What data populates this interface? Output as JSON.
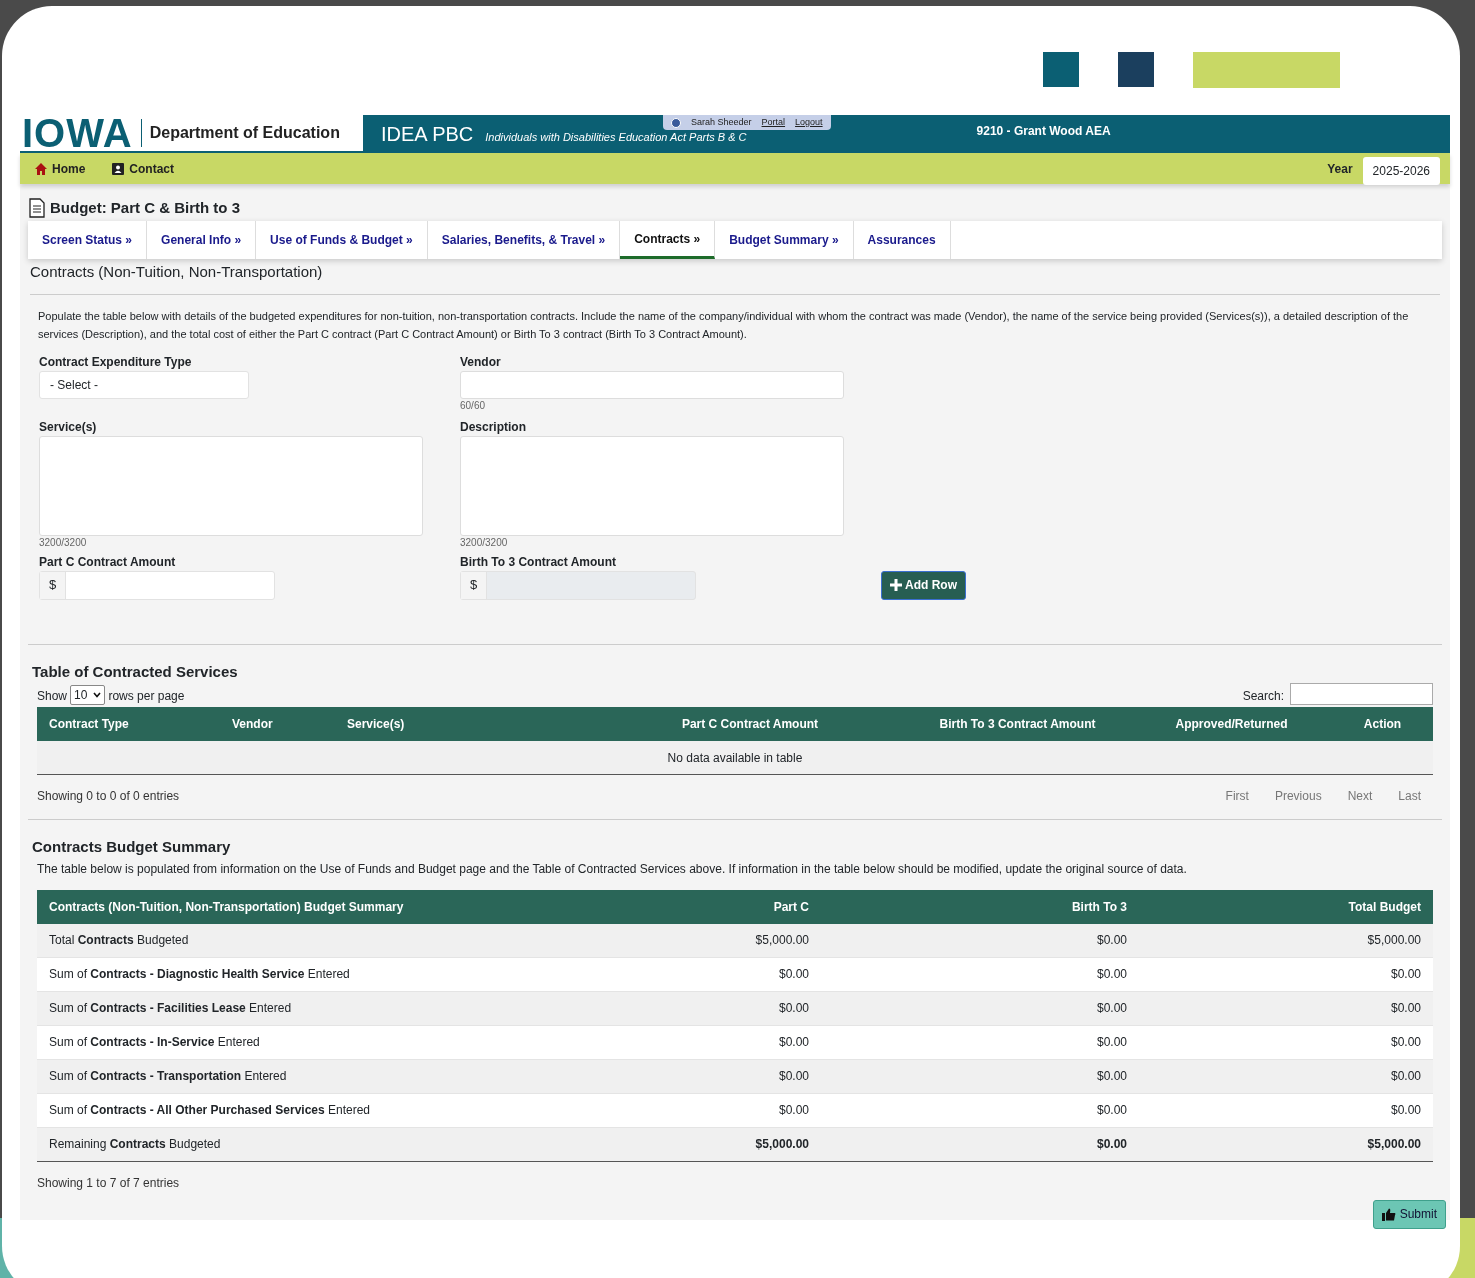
{
  "header": {
    "logo": "IOWA",
    "department": "Department of Education",
    "app_title": "IDEA PBC",
    "app_subtitle": "Individuals with Disabilities Education Act Parts B & C",
    "user": "Sarah Sheeder",
    "user_links": [
      "Portal",
      "Logout"
    ],
    "agency": "9210 - Grant Wood AEA"
  },
  "nav": {
    "items": [
      "Home",
      "Contact"
    ],
    "year_label": "Year",
    "year_value": "2025-2026"
  },
  "page_title": "Budget: Part C & Birth to 3",
  "tabs": [
    {
      "label": "Screen Status »",
      "selected": false
    },
    {
      "label": "General Info »",
      "selected": false
    },
    {
      "label": "Use of Funds & Budget »",
      "selected": false
    },
    {
      "label": "Salaries, Benefits, & Travel »",
      "selected": false
    },
    {
      "label": "Contracts »",
      "selected": true
    },
    {
      "label": "Budget Summary »",
      "selected": false
    },
    {
      "label": "Assurances",
      "selected": false
    }
  ],
  "section_title": "Contracts (Non-Tuition, Non-Transportation)",
  "instructions": "Populate the table below with details of the budgeted expenditures for non-tuition, non-transportation contracts. Include the name of the company/individual with whom the contract was made (Vendor), the name of the service being provided (Services(s)), a detailed description of the services (Description), and the total cost of either the Part C contract (Part C Contract Amount) or Birth To 3 contract (Birth To 3 Contract Amount).",
  "form": {
    "expenditure_type": {
      "label": "Contract Expenditure Type",
      "value": "- Select -"
    },
    "vendor": {
      "label": "Vendor",
      "counter": "60/60"
    },
    "services": {
      "label": "Service(s)",
      "counter": "3200/3200"
    },
    "description": {
      "label": "Description",
      "counter": "3200/3200"
    },
    "part_c_amount": {
      "label": "Part C Contract Amount",
      "prefix": "$",
      "disabled": false
    },
    "birth_to_3_amount": {
      "label": "Birth To 3 Contract Amount",
      "prefix": "$",
      "disabled": true
    },
    "add_button": "Add Row"
  },
  "contracted_table": {
    "title": "Table of Contracted Services",
    "show_label": "Show",
    "page_size": "10",
    "rows_per_page_label": "rows per page",
    "search_label": "Search:",
    "columns": [
      "Contract Type",
      "Vendor",
      "Service(s)",
      "Part C Contract Amount",
      "Birth To 3 Contract Amount",
      "Approved/Returned",
      "Action"
    ],
    "empty_message": "No data available in table",
    "info": "Showing 0 to 0 of 0 entries",
    "pagination": [
      "First",
      "Previous",
      "Next",
      "Last"
    ]
  },
  "summary": {
    "title": "Contracts Budget Summary",
    "description": "The table below is populated from information on the Use of Funds and Budget page and the Table of Contracted Services above. If information in the table below should be modified, update the original source of data.",
    "columns": [
      "Contracts (Non-Tuition, Non-Transportation) Budget Summary",
      "Part C",
      "Birth To 3",
      "Total Budget"
    ],
    "rows": [
      {
        "label": "Total **Contracts** Budgeted",
        "values": [
          "$5,000.00",
          "$0.00",
          "$5,000.00"
        ],
        "bold": false
      },
      {
        "label": "Sum of **Contracts - Diagnostic Health Service** Entered",
        "values": [
          "$0.00",
          "$0.00",
          "$0.00"
        ],
        "bold": false
      },
      {
        "label": "Sum of **Contracts - Facilities Lease** Entered",
        "values": [
          "$0.00",
          "$0.00",
          "$0.00"
        ],
        "bold": false
      },
      {
        "label": "Sum of **Contracts - In-Service** Entered",
        "values": [
          "$0.00",
          "$0.00",
          "$0.00"
        ],
        "bold": false
      },
      {
        "label": "Sum of **Contracts - Transportation** Entered",
        "values": [
          "$0.00",
          "$0.00",
          "$0.00"
        ],
        "bold": false
      },
      {
        "label": "Sum of **Contracts - All Other Purchased Services** Entered",
        "values": [
          "$0.00",
          "$0.00",
          "$0.00"
        ],
        "bold": false
      },
      {
        "label": "Remaining **Contracts** Budgeted",
        "values": [
          "$5,000.00",
          "$0.00",
          "$5,000.00"
        ],
        "bold": true
      }
    ],
    "info": "Showing 1 to 7 of 7 entries"
  },
  "submit_button": "Submit"
}
